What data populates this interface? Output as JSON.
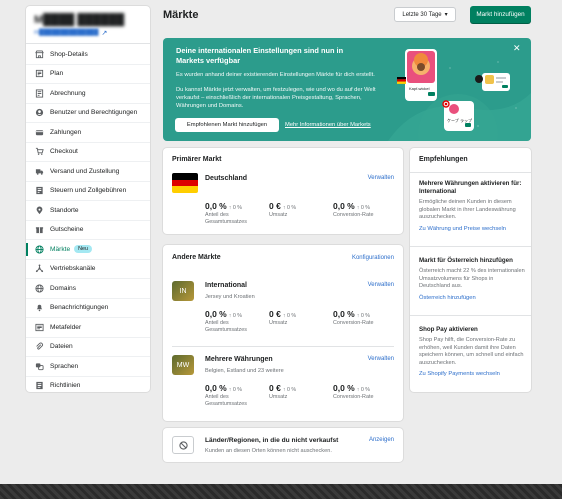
{
  "sidebar": {
    "store_name": "M████ ██████",
    "store_url": "m██████████████",
    "items": [
      {
        "label": "Shop-Details",
        "icon": "store-icon"
      },
      {
        "label": "Plan",
        "icon": "plan-icon"
      },
      {
        "label": "Abrechnung",
        "icon": "billing-icon"
      },
      {
        "label": "Benutzer und Berechtigungen",
        "icon": "user-icon"
      },
      {
        "label": "Zahlungen",
        "icon": "payments-icon"
      },
      {
        "label": "Checkout",
        "icon": "cart-icon"
      },
      {
        "label": "Versand und Zustellung",
        "icon": "truck-icon"
      },
      {
        "label": "Steuern und Zollgebühren",
        "icon": "taxes-icon"
      },
      {
        "label": "Standorte",
        "icon": "location-icon"
      },
      {
        "label": "Gutscheine",
        "icon": "gift-icon"
      },
      {
        "label": "Märkte",
        "icon": "globe-icon",
        "badge": "Neu",
        "active": true
      },
      {
        "label": "Vertriebskanäle",
        "icon": "channels-icon"
      },
      {
        "label": "Domains",
        "icon": "globe-icon"
      },
      {
        "label": "Benachrichtigungen",
        "icon": "bell-icon"
      },
      {
        "label": "Metafelder",
        "icon": "metafields-icon"
      },
      {
        "label": "Dateien",
        "icon": "paperclip-icon"
      },
      {
        "label": "Sprachen",
        "icon": "language-icon"
      },
      {
        "label": "Richtlinien",
        "icon": "policies-icon"
      }
    ]
  },
  "header": {
    "title": "Märkte",
    "date_range": "Letzte 30 Tage",
    "add_market": "Markt hinzufügen"
  },
  "banner": {
    "title": "Deine internationalen Einstellungen sind nun in Markets verfügbar",
    "p1": "Es wurden anhand deiner existierenden Einstellungen Märkte für dich erstellt.",
    "p2": "Du kannst Märkte jetzt verwalten, um festzulegen, wie und wo du auf der Welt verkaufst – einschließlich der internationalen Preisgestaltung, Sprachen, Währungen und Domains.",
    "primary_btn": "Empfohlenen Markt hinzufügen",
    "link": "Mehr Informationen über Markets",
    "art_label_1": "Kapf-wickel",
    "art_label_2": "ケープ ラップ",
    "colors": {
      "background": "#2c9c8c",
      "primary": "#008060"
    }
  },
  "primary_market": {
    "heading": "Primärer Markt",
    "name": "Deutschland",
    "manage": "Verwalten",
    "stats": [
      {
        "value": "0,0 %",
        "delta": "↑ 0 %",
        "label": "Anteil des Gesamtumsatzes"
      },
      {
        "value": "0 €",
        "delta": "↑ 0 %",
        "label": "Umsatz"
      },
      {
        "value": "0,0 %",
        "delta": "↑ 0 %",
        "label": "Conversion-Rate"
      }
    ]
  },
  "other_markets": {
    "heading": "Andere Märkte",
    "config": "Konfigurationen",
    "markets": [
      {
        "badge": "IN",
        "name": "International",
        "sub": "Jersey und Kroatien",
        "manage": "Verwalten",
        "stats": [
          {
            "value": "0,0 %",
            "delta": "↑ 0 %",
            "label": "Anteil des Gesamtumsatzes"
          },
          {
            "value": "0 €",
            "delta": "↑ 0 %",
            "label": "Umsatz"
          },
          {
            "value": "0,0 %",
            "delta": "↑ 0 %",
            "label": "Conversion-Rate"
          }
        ]
      },
      {
        "badge": "MW",
        "name": "Mehrere Währungen",
        "sub": "Belgien, Estland und 23 weitere",
        "manage": "Verwalten",
        "stats": [
          {
            "value": "0,0 %",
            "delta": "↑ 0 %",
            "label": "Anteil des Gesamtumsatzes"
          },
          {
            "value": "0 €",
            "delta": "↑ 0 %",
            "label": "Umsatz"
          },
          {
            "value": "0,0 %",
            "delta": "↑ 0 %",
            "label": "Conversion-Rate"
          }
        ]
      }
    ]
  },
  "not_selling": {
    "title": "Länder/Regionen, in die du nicht verkaufst",
    "sub": "Kunden an diesen Orten können nicht auschecken.",
    "link": "Anzeigen"
  },
  "recommendations": {
    "heading": "Empfehlungen",
    "items": [
      {
        "title": "Mehrere Währungen aktivieren für: International",
        "body": "Ermögliche deinen Kunden in diesem globalen Markt in ihrer Landeswährung auszuchecken.",
        "link": "Zu Währung und Preise wechseln"
      },
      {
        "title": "Markt für Österreich hinzufügen",
        "body": "Österreich macht 22 % des internationalen Umsatzvolumens für Shops in Deutschland aus.",
        "link": "Österreich hinzufügen"
      },
      {
        "title": "Shop Pay aktivieren",
        "body": "Shop Pay hilft, die Conversion-Rate zu erhöhen, weil Kunden damit ihre Daten speichern können, um schnell und einfach auszuchecken.",
        "link": "Zu Shopify Payments wechseln"
      }
    ]
  }
}
